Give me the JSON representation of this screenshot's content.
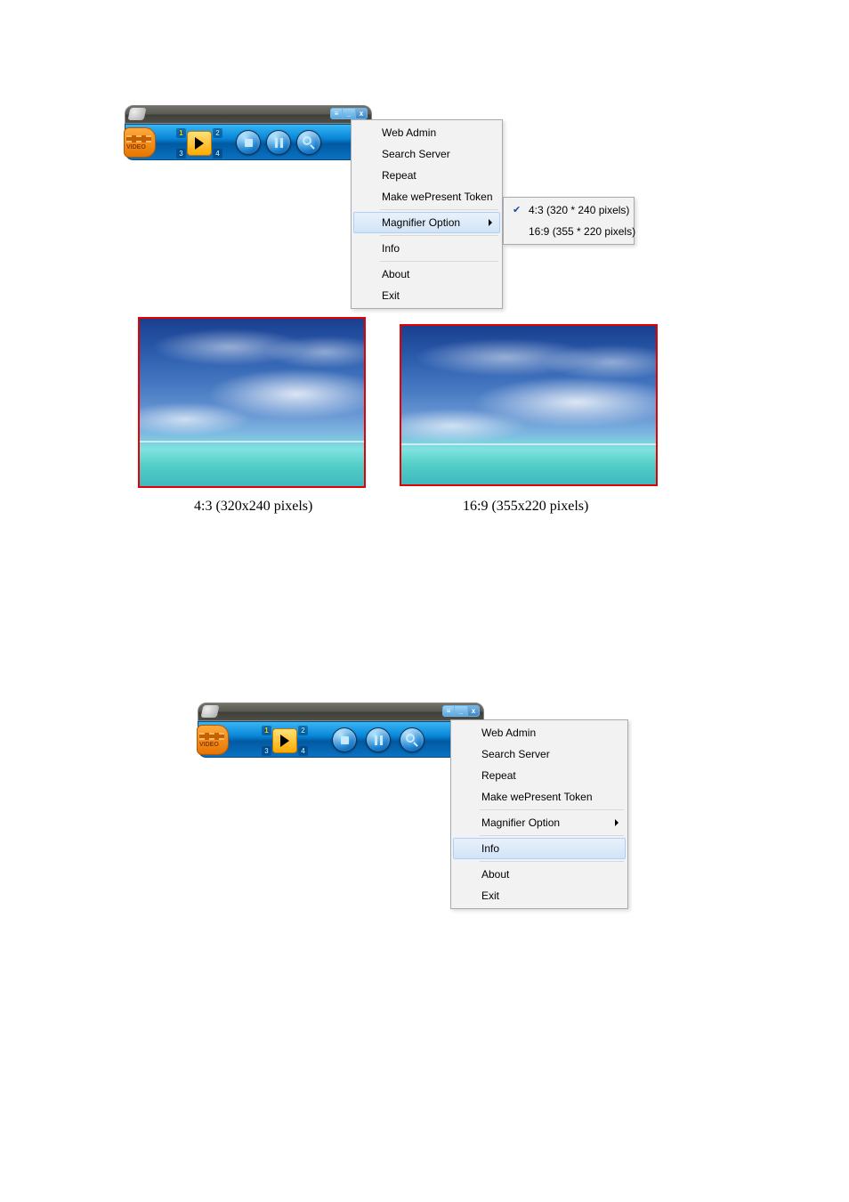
{
  "menu1": {
    "items": [
      {
        "label": "Web Admin"
      },
      {
        "label": "Search Server"
      },
      {
        "label": "Repeat"
      },
      {
        "label": "Make wePresent Token"
      }
    ],
    "magnifier_label": "Magnifier Option",
    "info_label": "Info",
    "about_label": "About",
    "exit_label": "Exit",
    "submenu": {
      "opt43": "4:3  (320 * 240 pixels)",
      "opt169": "16:9 (355 * 220 pixels)"
    }
  },
  "menu2": {
    "items": [
      {
        "label": "Web Admin"
      },
      {
        "label": "Search Server"
      },
      {
        "label": "Repeat"
      },
      {
        "label": "Make wePresent Token"
      }
    ],
    "magnifier_label": "Magnifier Option",
    "info_label": "Info",
    "about_label": "About",
    "exit_label": "Exit"
  },
  "captions": {
    "ratio43": "4:3 (320x240 pixels)",
    "ratio169": "16:9 (355x220 pixels)"
  },
  "toolbar": {
    "video_label": "VIDEO",
    "quad": {
      "n1": "1",
      "n2": "2",
      "n3": "3",
      "n4": "4"
    }
  }
}
